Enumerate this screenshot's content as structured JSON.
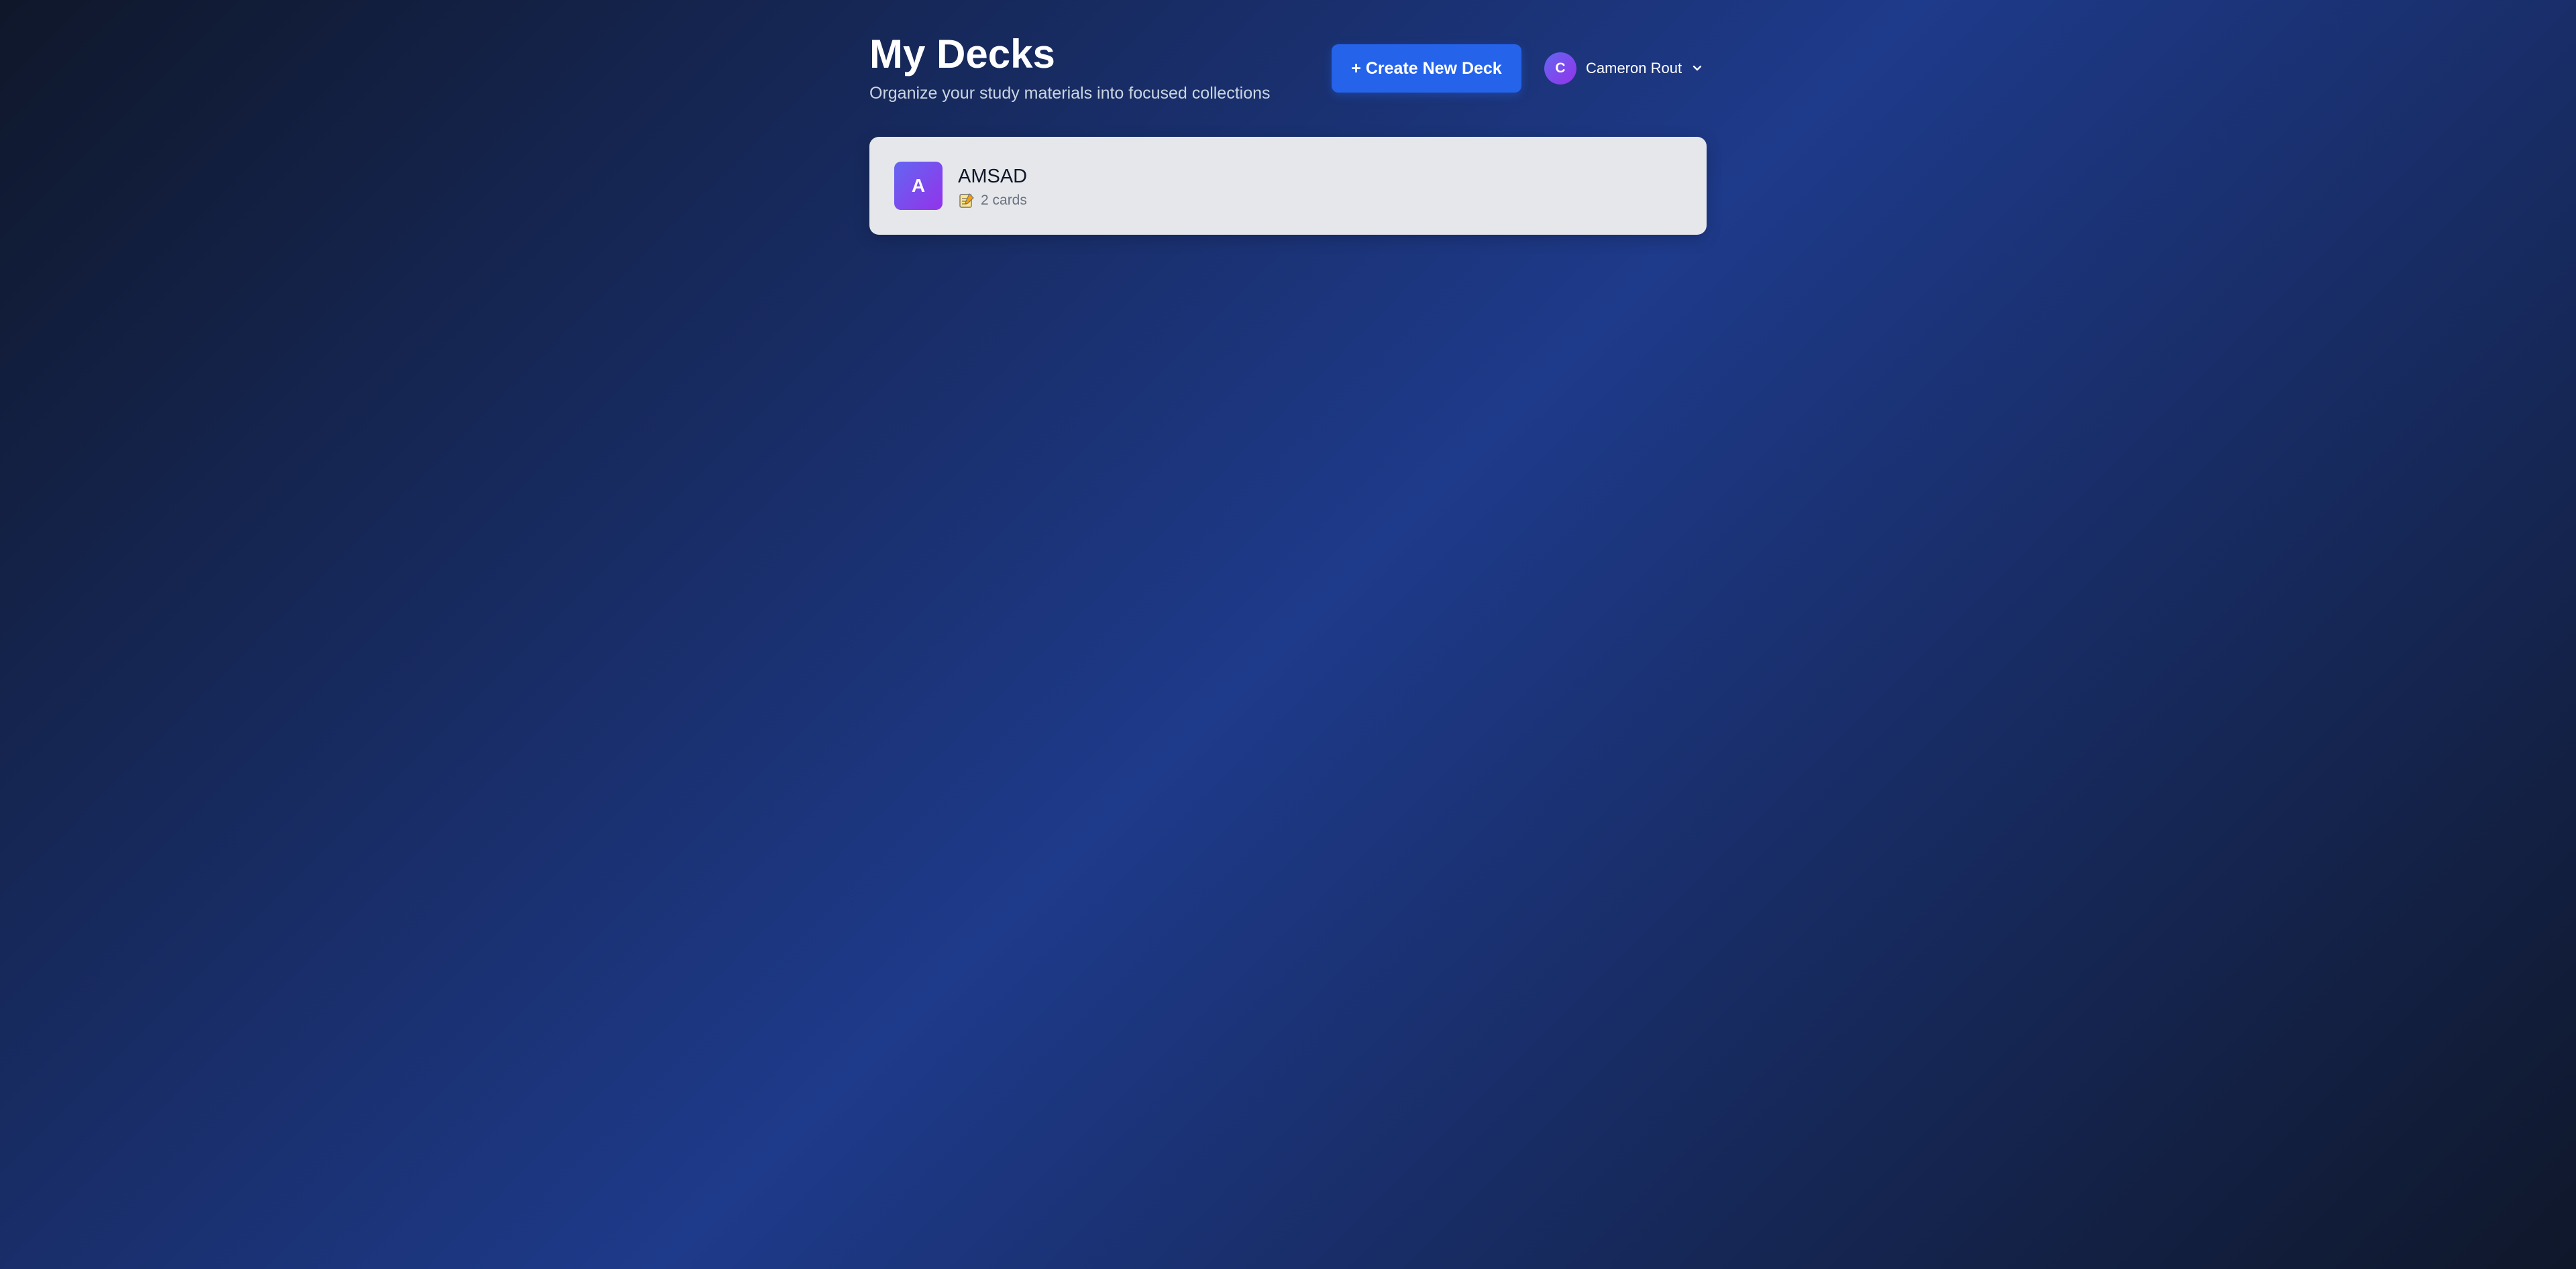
{
  "header": {
    "title": "My Decks",
    "subtitle": "Organize your study materials into focused collections",
    "create_button_label": "+ Create New Deck"
  },
  "user": {
    "initial": "C",
    "name": "Cameron Rout"
  },
  "decks": [
    {
      "initial": "A",
      "name": "AMSAD",
      "card_count_label": "2 cards",
      "meta_icon": "memo-icon"
    }
  ],
  "colors": {
    "accent": "#2563eb",
    "avatar_gradient_start": "#6366f1",
    "avatar_gradient_end": "#9333ea",
    "background_dark": "#0f172a",
    "background_mid": "#1e3a8a",
    "card_background": "#e5e7eb"
  }
}
